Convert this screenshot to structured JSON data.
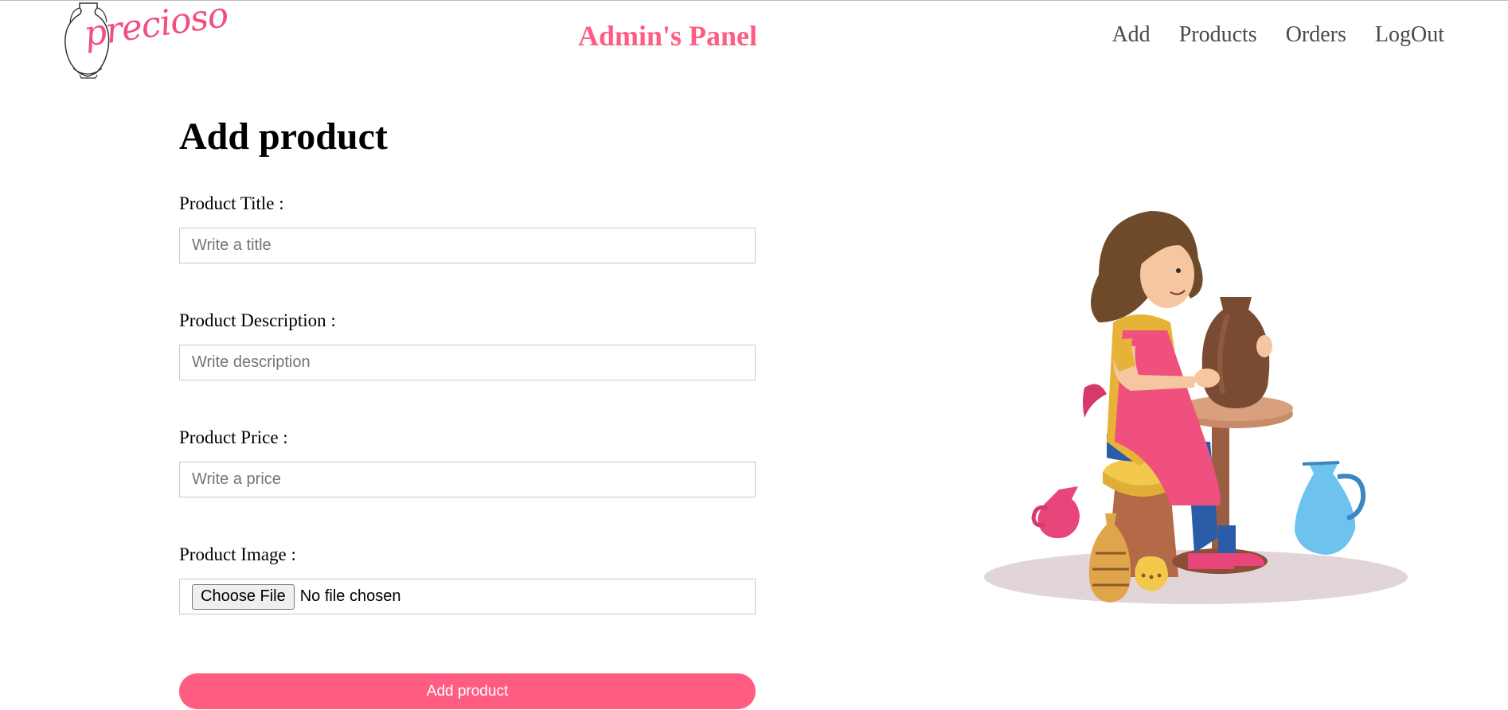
{
  "brand": {
    "logo_text": "precioso"
  },
  "header": {
    "title": "Admin's Panel"
  },
  "nav": {
    "items": [
      "Add",
      "Products",
      "Orders",
      "LogOut"
    ]
  },
  "form": {
    "heading": "Add product",
    "fields": [
      {
        "label": "Product Title :",
        "placeholder": "Write a title"
      },
      {
        "label": "Product Description :",
        "placeholder": "Write description"
      },
      {
        "label": "Product Price :",
        "placeholder": "Write a price"
      },
      {
        "label": "Product Image :",
        "button": "Choose File",
        "status": "No file chosen"
      }
    ],
    "submit_label": "Add product"
  },
  "colors": {
    "accent": "#ff5c82",
    "nav_text": "#4a4a4a",
    "border": "#c9c9c9"
  },
  "icons": {
    "logo": "vase-logo-icon",
    "illustration": "pottery-girl-illustration"
  }
}
